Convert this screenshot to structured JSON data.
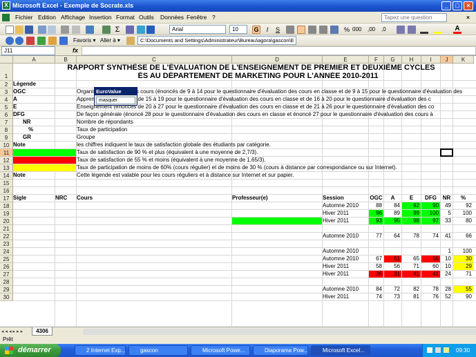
{
  "window": {
    "title": "Microsoft Excel - Exemple de Socrate.xls",
    "buttons": [
      "_",
      "□",
      "×"
    ]
  },
  "menu": {
    "items": [
      "Fichier",
      "Edition",
      "Affichage",
      "Insertion",
      "Format",
      "Outils",
      "Données",
      "Fenêtre",
      "?"
    ],
    "ask_placeholder": "Tapez une question",
    "close": "×"
  },
  "toolbar": {
    "font": "Arial",
    "size": "10",
    "bold": "G",
    "italic": "I",
    "underline": "S",
    "percent": "%",
    "thousands": "000",
    "inc_dec": ",00",
    "dec_dec": ",0",
    "font_color": "A"
  },
  "webbar": {
    "favoris": "Favoris ▾",
    "aller": "Aller à ▾",
    "path": "C:\\Documents and Settings\\Administrateur\\Bureau\\agora\\gascon\\E"
  },
  "formula": {
    "namebox": "J11",
    "fx": "fx",
    "value": ""
  },
  "columns": [
    "A",
    "B",
    "C",
    "D",
    "E",
    "F",
    "G",
    "H",
    "I",
    "J",
    "K"
  ],
  "rows": [
    {
      "n": "1",
      "h": 25
    },
    {
      "n": "2",
      "h": 11
    },
    {
      "n": "3",
      "h": 11
    },
    {
      "n": "4",
      "h": 11
    },
    {
      "n": "5",
      "h": 11
    },
    {
      "n": "6",
      "h": 11
    },
    {
      "n": "7",
      "h": 11
    },
    {
      "n": "8",
      "h": 11
    },
    {
      "n": "9",
      "h": 11
    },
    {
      "n": "10",
      "h": 11
    },
    {
      "n": "11",
      "h": 11
    },
    {
      "n": "12",
      "h": 11
    },
    {
      "n": "13",
      "h": 11
    },
    {
      "n": "14",
      "h": 11
    },
    {
      "n": "15",
      "h": 11
    },
    {
      "n": "16",
      "h": 11
    },
    {
      "n": "17",
      "h": 11
    },
    {
      "n": "18",
      "h": 11
    },
    {
      "n": "19",
      "h": 11
    },
    {
      "n": "20",
      "h": 11
    },
    {
      "n": "21",
      "h": 11
    },
    {
      "n": "22",
      "h": 11
    },
    {
      "n": "23",
      "h": 11
    },
    {
      "n": "24",
      "h": 11
    },
    {
      "n": "25",
      "h": 11
    },
    {
      "n": "26",
      "h": 11
    },
    {
      "n": "27",
      "h": 11
    },
    {
      "n": "28",
      "h": 11
    },
    {
      "n": "29",
      "h": 11
    },
    {
      "n": "30",
      "h": 11
    }
  ],
  "title": {
    "line1": "RAPPORT SYNTHÈSE DE L'ÉVALUATION DE L'ENSEIGNEMENT DE PREMIER ET DEUXIÈME CYCLES",
    "line2": "ÉS AU DÉPARTEMENT DE MARKETING POUR L'ANNÉE 2010-2011"
  },
  "legend": {
    "header": "Légende",
    "items": [
      {
        "code": "OGC",
        "text": "Organisation générale du cours (énoncés de 9 à 14 pour le questionnaire d'évaluation des cours en classe et de 9 à 15 pour le questionnaire d'évaluation des"
      },
      {
        "code": "A",
        "text": "Apprentissage  (énoncés de 15 à 19 pour le questionnaire d'évaluation des cours en classe et de 16 à 20 pour le questionnaire d'évaluation des c"
      },
      {
        "code": "E",
        "text": "Enseignement (énoncés de 20 à 27 pour le questionnaire d'évaluation des cours en classe et de 21 à 26 pour le questionnaire d'évaluation des co"
      },
      {
        "code": "DFG",
        "text": "De façon générale (énoncé 28 pour le questionnaire d'évaluation des cours en classe et énoncé 27 pour le questionnaire d'évaluation des cours à"
      },
      {
        "code": "NR",
        "text": "Nombre de répondants"
      },
      {
        "code": "%",
        "text": "Taux de participation"
      },
      {
        "code": "GR",
        "text": "Groupe"
      }
    ],
    "note_label": "Note",
    "note_text": "les chiffres indiquent le taux de satisfaction globale des étudiants par catégorie.",
    "green_text": "Taux de satisfaction de 90 % et plus (équivalent à une moyenne de 2,7/3).",
    "red_text": "Taux de satisfaction de 55 % et moins (équivalent à une moyenne de 1,65/3).",
    "yellow_text": "Taux de participation de moins de 60% (cours régulier) et de moins de 30 % (cours à distance par correspondance ou sur Internet).",
    "note2_label": "Note",
    "note2_text": "Cette légende est valable pour les cours réguliers et à distance sur Internet et sur papier."
  },
  "colors": {
    "green": "#00ff00",
    "red": "#ff0000",
    "yellow": "#ffff00"
  },
  "table": {
    "headers": {
      "sigle": "Sigle",
      "nrc": "NRC",
      "cours": "Cours",
      "prof": "Professeur(e)",
      "session": "Session",
      "ogc": "OGC",
      "a": "A",
      "e": "E",
      "dfg": "DFG",
      "nr": "NR",
      "pct": "%"
    },
    "rows": [
      {
        "row": "18",
        "session": "Automne 2010",
        "vals": [
          "88",
          "84",
          "92",
          "90",
          "49",
          "92"
        ],
        "colors": [
          "",
          "",
          "g",
          "g",
          "",
          ""
        ]
      },
      {
        "row": "19",
        "session": "Hiver 2011",
        "vals": [
          "96",
          "89",
          "99",
          "100",
          "5",
          "100"
        ],
        "colors": [
          "g",
          "",
          "g",
          "g",
          "",
          ""
        ]
      },
      {
        "row": "20",
        "session": "Hiver 2011",
        "vals": [
          "93",
          "95",
          "98",
          "97",
          "33",
          "80"
        ],
        "colors": [
          "g",
          "g",
          "g",
          "g",
          "",
          ""
        ],
        "profgreen": true
      },
      {
        "row": "22",
        "session": "Automne 2010",
        "vals": [
          "77",
          "64",
          "78",
          "74",
          "41",
          "66"
        ],
        "colors": [
          "",
          "",
          "",
          "",
          "",
          ""
        ]
      },
      {
        "row": "24",
        "session": "Automne 2010",
        "vals": [
          "",
          "",
          "",
          "",
          "1",
          "100"
        ],
        "colors": [
          "",
          "",
          "",
          "",
          "",
          ""
        ]
      },
      {
        "row": "25",
        "session": "Automne 2010",
        "vals": [
          "67",
          "51",
          "65",
          "56",
          "10",
          "30"
        ],
        "colors": [
          "",
          "r",
          "",
          "r",
          "",
          "y"
        ]
      },
      {
        "row": "26",
        "session": "Hiver 2011",
        "vals": [
          "58",
          "56",
          "71",
          "60",
          "10",
          "29"
        ],
        "colors": [
          "",
          "",
          "",
          "",
          "",
          "y"
        ]
      },
      {
        "row": "27",
        "session": "Hiver 2011",
        "vals": [
          "36",
          "31",
          "41",
          "41",
          "24",
          "71"
        ],
        "colors": [
          "r",
          "r",
          "r",
          "r",
          "",
          ""
        ]
      },
      {
        "row": "29",
        "session": "Automne 2010",
        "vals": [
          "84",
          "72",
          "82",
          "78",
          "28",
          "55"
        ],
        "colors": [
          "",
          "",
          "",
          "",
          "",
          "y"
        ]
      },
      {
        "row": "30",
        "session": "Hiver 2011",
        "vals": [
          "74",
          "73",
          "81",
          "76",
          "52",
          "90"
        ],
        "colors": [
          "",
          "",
          "",
          "",
          "",
          ""
        ]
      }
    ]
  },
  "eurovalue": {
    "title": "EuroValue",
    "select": "masquer"
  },
  "sheet_tab": "4306",
  "status": "Prêt",
  "taskbar": {
    "start": "démarrer",
    "tasks": [
      "2 Internet Exp...",
      "gascon",
      "Microsoft Powe...",
      "Diaporama Pow...",
      "Microsoft Excel..."
    ],
    "clock": "09:30"
  }
}
